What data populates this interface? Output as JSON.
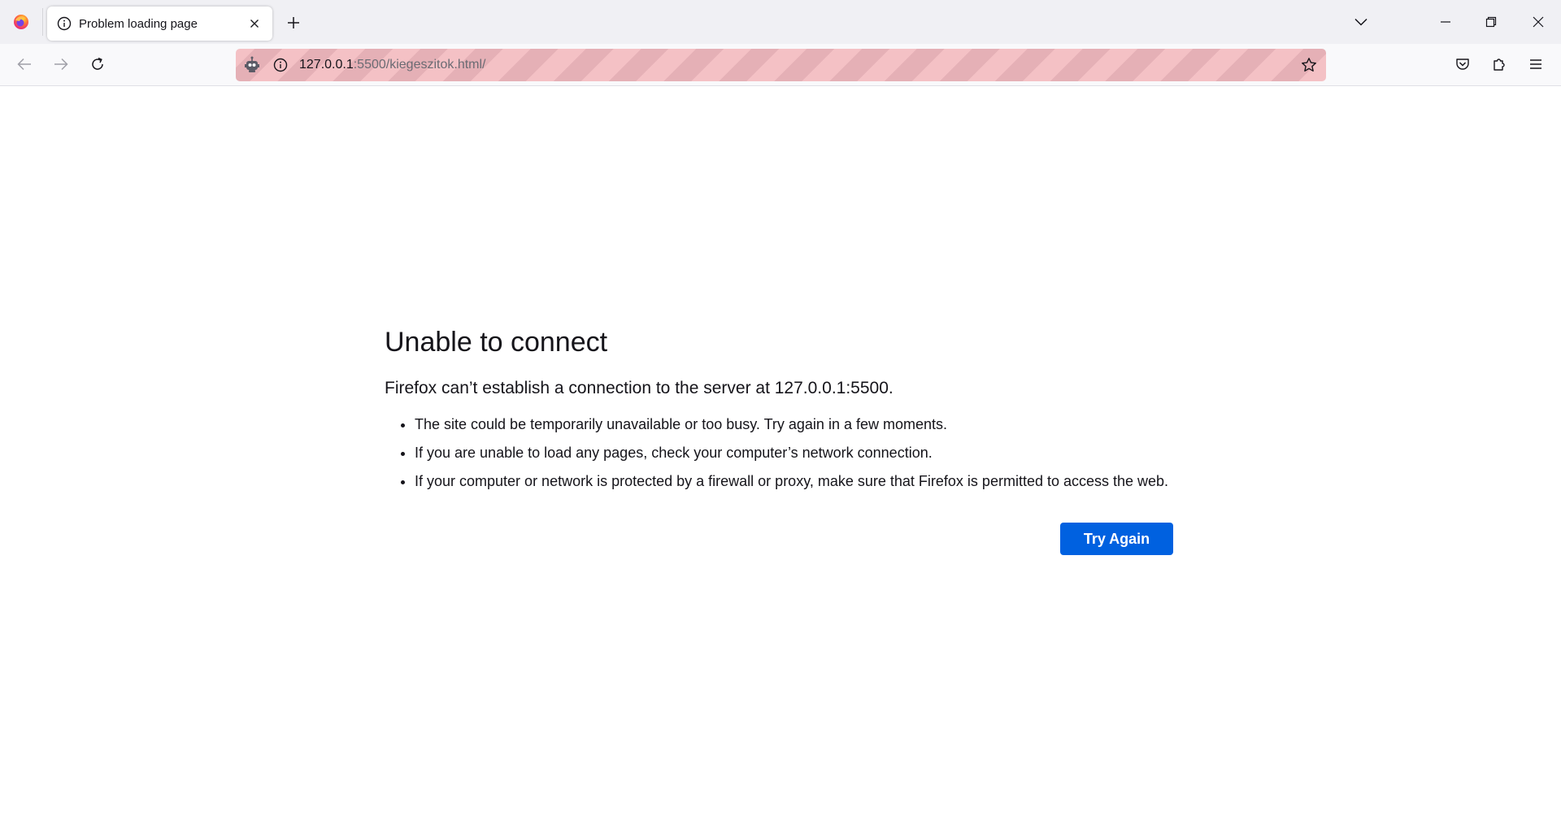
{
  "browser": {
    "tab": {
      "title": "Problem loading page"
    },
    "urlbar": {
      "host": "127.0.0.1",
      "path": ":5500/kiegeszitok.html/"
    },
    "icons": {
      "app_menu": "firefox-logo-icon",
      "tab_favicon": "info-icon",
      "tab_close": "close-icon",
      "new_tab": "plus-icon",
      "tab_list": "chevron-down-icon",
      "back": "arrow-left-icon",
      "forward": "arrow-right-icon",
      "reload": "reload-icon",
      "remote_control": "robot-icon",
      "site_info": "info-icon",
      "bookmark": "star-icon",
      "pocket": "pocket-icon",
      "extensions": "puzzle-icon",
      "menu": "hamburger-icon"
    },
    "colors": {
      "tabstrip_bg": "#f0f0f4",
      "navbar_bg": "#f9f9fb",
      "urlbar_stripe_a": "#f4c1c5",
      "urlbar_stripe_b": "#e5b0b6",
      "accent": "#0061e0"
    }
  },
  "error": {
    "title": "Unable to connect",
    "description": "Firefox can’t establish a connection to the server at 127.0.0.1:5500.",
    "reasons": [
      "The site could be temporarily unavailable or too busy. Try again in a few moments.",
      "If you are unable to load any pages, check your computer’s network connection.",
      "If your computer or network is protected by a firewall or proxy, make sure that Firefox is permitted to access the web."
    ],
    "try_again_label": "Try Again"
  }
}
